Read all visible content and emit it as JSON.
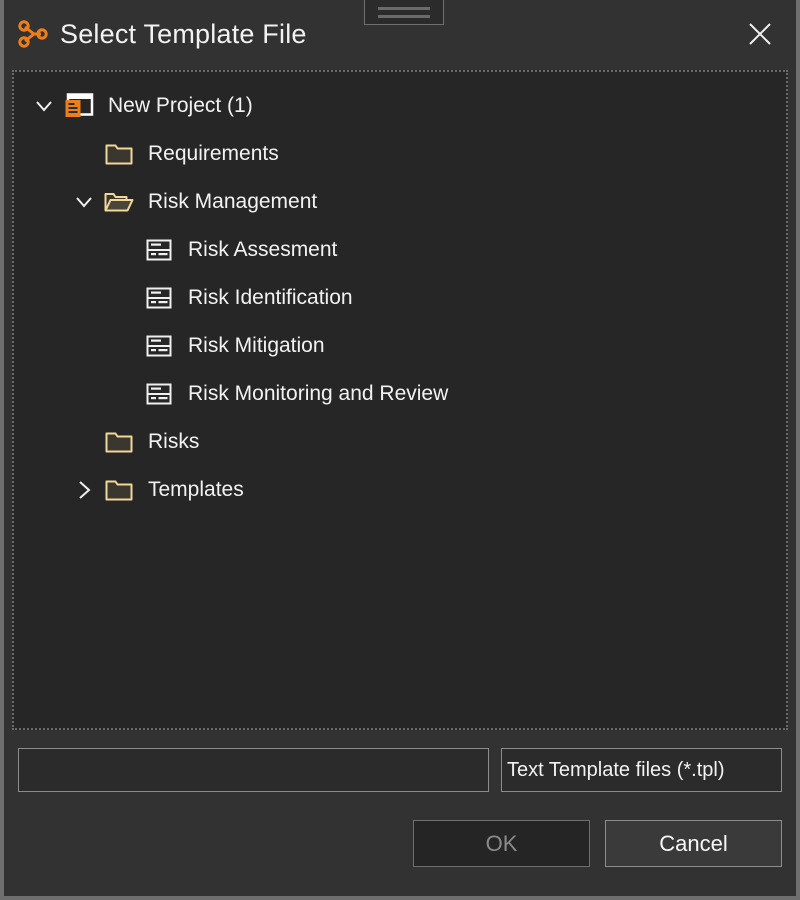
{
  "window": {
    "title": "Select Template File",
    "app_icon": "node-graph-icon",
    "close_icon": "close-icon",
    "handle_icon": "drag-handle-icon",
    "accent_color": "#ef7d18",
    "folder_color": "#f0d79c",
    "background": "#323232",
    "tree_background": "#262626"
  },
  "tree": {
    "items": [
      {
        "label": "New Project (1)",
        "icon": "project-icon",
        "twisty": "expanded",
        "depth": 0
      },
      {
        "label": "Requirements",
        "icon": "folder-closed-icon",
        "twisty": "none",
        "depth": 1
      },
      {
        "label": "Risk Management",
        "icon": "folder-open-icon",
        "twisty": "expanded",
        "depth": 1
      },
      {
        "label": "Risk Assesment",
        "icon": "table-file-icon",
        "twisty": "none",
        "depth": 2
      },
      {
        "label": "Risk Identification",
        "icon": "table-file-icon",
        "twisty": "none",
        "depth": 2
      },
      {
        "label": "Risk Mitigation",
        "icon": "table-file-icon",
        "twisty": "none",
        "depth": 2
      },
      {
        "label": "Risk Monitoring and Review",
        "icon": "table-file-icon",
        "twisty": "none",
        "depth": 2
      },
      {
        "label": "Risks",
        "icon": "folder-closed-icon",
        "twisty": "none",
        "depth": 1
      },
      {
        "label": "Templates",
        "icon": "folder-closed-icon",
        "twisty": "collapsed",
        "depth": 1
      }
    ]
  },
  "footer": {
    "filename_value": "",
    "filename_placeholder": "",
    "filter_value": "Text Template files (*.tpl)",
    "ok_label": "OK",
    "ok_enabled": false,
    "cancel_label": "Cancel"
  }
}
